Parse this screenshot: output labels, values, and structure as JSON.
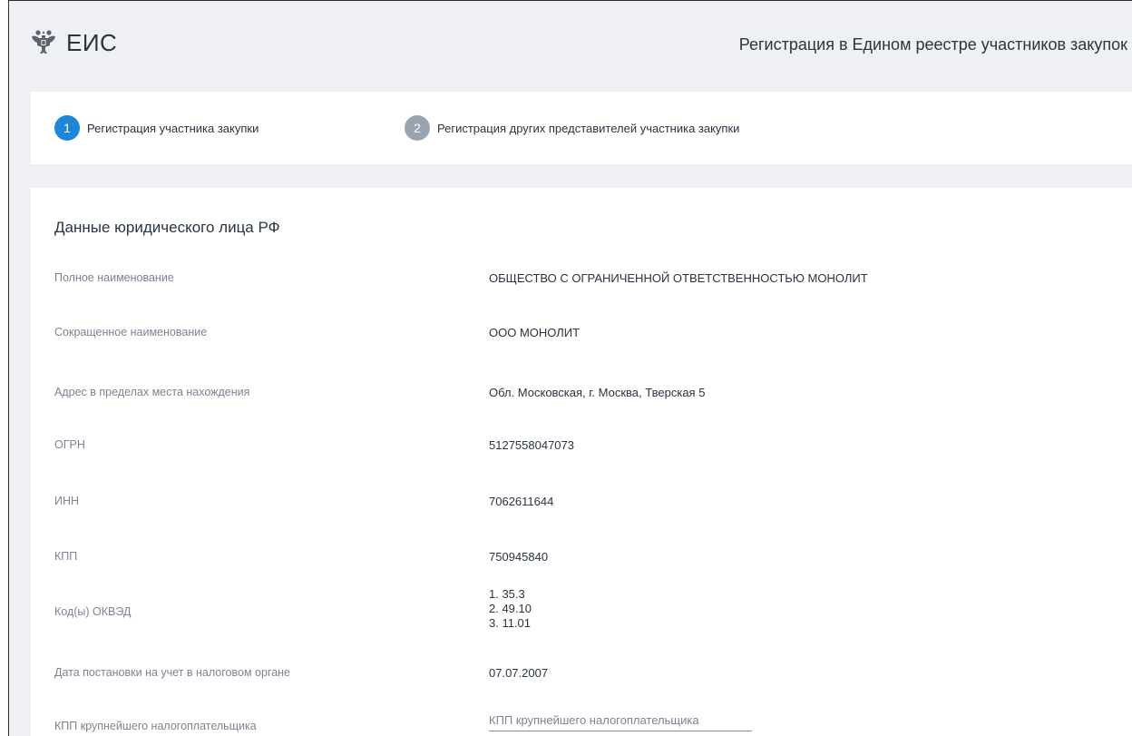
{
  "header": {
    "logo_text": "ЕИС",
    "title": "Регистрация в Едином реестре участников закупок"
  },
  "steps": [
    {
      "number": "1",
      "label": "Регистрация участника закупки",
      "state": "active"
    },
    {
      "number": "2",
      "label": "Регистрация других представителей участника закупки",
      "state": "inactive"
    }
  ],
  "section": {
    "title": "Данные юридического лица РФ",
    "fields": {
      "full_name": {
        "label": "Полное наименование",
        "value": "ОБЩЕСТВО С ОГРАНИЧЕННОЙ ОТВЕТСТВЕННОСТЬЮ МОНОЛИТ"
      },
      "short_name": {
        "label": "Сокращенное наименование",
        "value": "ООО МОНОЛИТ"
      },
      "address": {
        "label": "Адрес в пределах места нахождения",
        "value": "Обл. Московская, г. Москва, Тверская 5"
      },
      "ogrn": {
        "label": "ОГРН",
        "value": "5127558047073"
      },
      "inn": {
        "label": "ИНН",
        "value": "7062611644"
      },
      "kpp": {
        "label": "КПП",
        "value": "750945840"
      },
      "okved": {
        "label": "Код(ы) ОКВЭД",
        "values": [
          "1. 35.3",
          "2. 49.10",
          "3. 11.01"
        ]
      },
      "tax_date": {
        "label": "Дата постановки на учет в налоговом органе",
        "value": "07.07.2007"
      },
      "largest_kpp": {
        "label": "КПП крупнейшего налогоплательщика",
        "placeholder": "КПП крупнейшего налогоплательщика",
        "value": ""
      }
    }
  },
  "icons": {
    "emblem": "double-headed-eagle-emblem-icon"
  },
  "colors": {
    "accent": "#1d86d8",
    "step_inactive": "#9aa3b2",
    "background": "#eef0f3",
    "text_primary": "#2a3442",
    "text_secondary": "#7b8494"
  }
}
